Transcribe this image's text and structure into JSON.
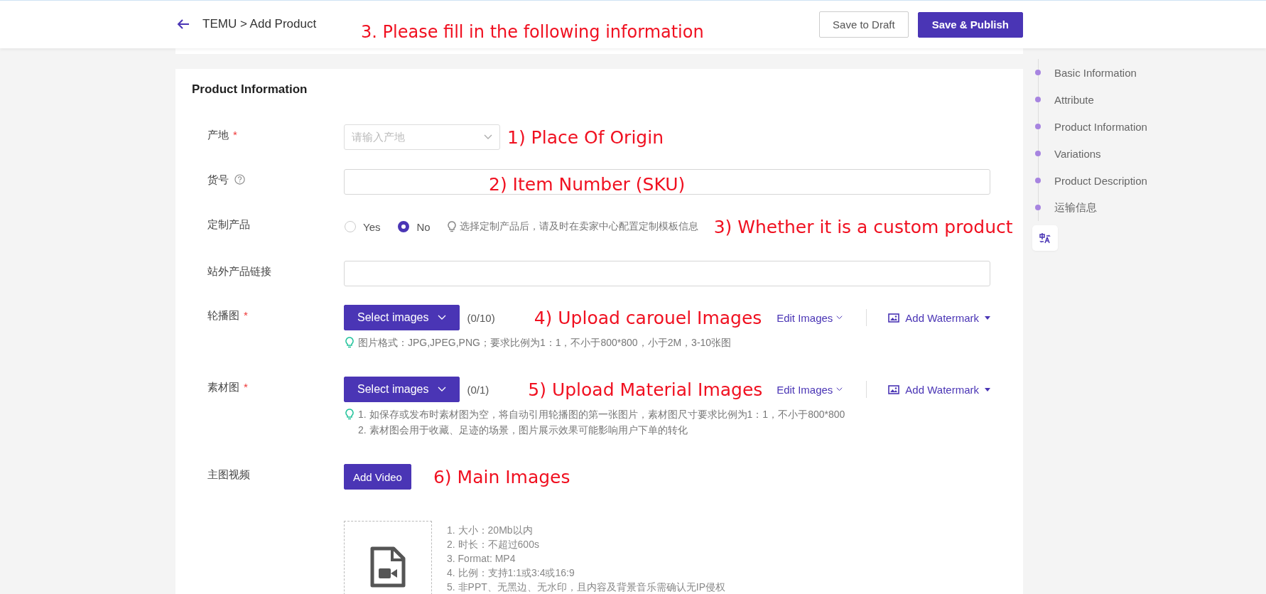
{
  "header": {
    "breadcrumb": "TEMU > Add Product",
    "annotation": "3. Please fill in the following information",
    "buttons": [
      {
        "label": "Save to Draft",
        "kind": "secondary"
      },
      {
        "label": "Save & Publish",
        "kind": "primary"
      }
    ]
  },
  "card": {
    "title": "Product Information",
    "rows": [
      {
        "kind": "select",
        "label": "产地",
        "required_mark": "*",
        "placeholder": "请输入产地",
        "annotation": "1) Place Of Origin"
      },
      {
        "kind": "input",
        "label": "货号",
        "help": true,
        "annotation": "2) Item Number (SKU)"
      },
      {
        "kind": "radio",
        "label": "定制产品",
        "options": [
          {
            "label": "Yes",
            "selected": false
          },
          {
            "label": "No",
            "selected": true
          }
        ],
        "hint": "选择定制产品后，请及时在卖家中心配置定制模板信息",
        "annotation": "3) Whether it is a custom product"
      },
      {
        "kind": "input",
        "label": "站外产品链接"
      },
      {
        "kind": "upload",
        "label": "轮播图",
        "required_mark": "*",
        "button": "Select images",
        "count": "(0/10)",
        "annotation": "4) Upload carouel Images",
        "edit": "Edit Images",
        "watermark": "Add Watermark",
        "hints": [
          "图片格式：JPG,JPEG,PNG；要求比例为1：1，不小于800*800，小于2M，3-10张图"
        ]
      },
      {
        "kind": "upload",
        "label": "素材图",
        "required_mark": "*",
        "button": "Select images",
        "count": "(0/1)",
        "annotation": "5) Upload Material Images",
        "edit": "Edit Images",
        "watermark": "Add Watermark",
        "hints": [
          "1. 如保存或发布时素材图为空，将自动引用轮播图的第一张图片，素材图尺寸要求比例为1：1，不小于800*800",
          "2. 素材图会用于收藏、足迹的场景，图片展示效果可能影响用户下单的转化"
        ]
      },
      {
        "kind": "video",
        "label": "主图视频",
        "button": "Add Video",
        "annotation": "6) Main Images",
        "notes": [
          "1. 大小：20Mb以内",
          "2. 时长：不超过600s",
          "3. Format: MP4",
          "4. 比例：支持1:1或3:4或16:9",
          "5. 非PPT、无黑边、无水印，且内容及背景音乐需确认无IP侵权"
        ]
      }
    ]
  },
  "nav": {
    "items": [
      {
        "label": "Basic Information"
      },
      {
        "label": "Attribute"
      },
      {
        "label": "Product Information"
      },
      {
        "label": "Variations"
      },
      {
        "label": "Product Description"
      },
      {
        "label": "运输信息"
      }
    ]
  }
}
